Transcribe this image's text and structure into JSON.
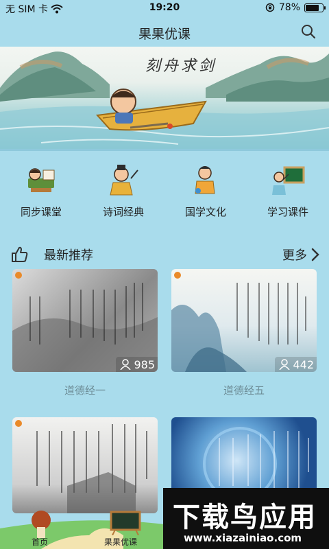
{
  "status": {
    "carrier": "无 SIM 卡",
    "time": "19:20",
    "battery_percent": 78,
    "battery_text": "78%"
  },
  "nav": {
    "title": "果果优课",
    "search_icon": "search-icon"
  },
  "banner": {
    "title": "刻舟求剑"
  },
  "categories": [
    {
      "label": "同步课堂",
      "icon": "classroom-icon"
    },
    {
      "label": "诗词经典",
      "icon": "poetry-icon"
    },
    {
      "label": "国学文化",
      "icon": "guoxue-icon"
    },
    {
      "label": "学习课件",
      "icon": "courseware-icon"
    }
  ],
  "section": {
    "title": "最新推荐",
    "more": "更多",
    "icon": "thumbs-up-icon"
  },
  "cards": [
    {
      "title": "道德经一",
      "views": "985"
    },
    {
      "title": "道德经五",
      "views": "442"
    },
    {
      "title": "",
      "views": ""
    },
    {
      "title": "",
      "views": ""
    }
  ],
  "tabbar": {
    "home": "首页",
    "brand": "果果优课"
  },
  "ad": {
    "title": "下载鸟应用",
    "url": "www.xiazainiao.com"
  },
  "colors": {
    "page_bg": "#a9dcec",
    "nav_text": "#222222",
    "card_title": "#6e8e98"
  }
}
